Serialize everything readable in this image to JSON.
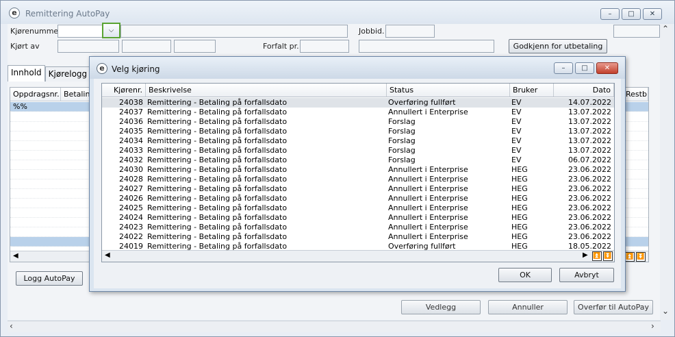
{
  "window": {
    "title": "Remittering AutoPay",
    "app_icon": "e",
    "controls": {
      "minimize": "–",
      "maximize": "□",
      "close": "✕"
    }
  },
  "form": {
    "kjorenummer_label": "Kjørenummer",
    "kjort_av_label": "Kjørt av",
    "forfalt_label": "Forfalt pr.",
    "jobbid_label": "Jobbid.",
    "dropdown_glyph": "⌵",
    "godkjenn_button": "Godkjenn for utbetaling"
  },
  "tabs": [
    {
      "label": "Innhold",
      "active": true
    },
    {
      "label": "Kjørelogg",
      "active": false
    }
  ],
  "grid": {
    "columns": [
      "Oppdragsnr.",
      "Betaling",
      "Restb"
    ],
    "first_row_value": "%%"
  },
  "bottom": {
    "logg_button": "Logg AutoPay",
    "vedlegg_button": "Vedlegg",
    "annuller_button": "Annuller",
    "overfor_button": "Overfør til AutoPay"
  },
  "dialog": {
    "title": "Velg kjøring",
    "columns": [
      "Kjørenr.",
      "Beskrivelse",
      "Status",
      "Bruker",
      "Dato"
    ],
    "rows": [
      {
        "nr": "24038",
        "beskrivelse": "Remittering - Betaling på forfallsdato",
        "status": "Overføring fullført",
        "bruker": "EV",
        "dato": "14.07.2022"
      },
      {
        "nr": "24037",
        "beskrivelse": "Remittering - Betaling på forfallsdato",
        "status": "Annullert i Enterprise",
        "bruker": "EV",
        "dato": "13.07.2022"
      },
      {
        "nr": "24036",
        "beskrivelse": "Remittering - Betaling på forfallsdato",
        "status": "Forslag",
        "bruker": "EV",
        "dato": "13.07.2022"
      },
      {
        "nr": "24035",
        "beskrivelse": "Remittering - Betaling på forfallsdato",
        "status": "Forslag",
        "bruker": "EV",
        "dato": "13.07.2022"
      },
      {
        "nr": "24034",
        "beskrivelse": "Remittering - Betaling på forfallsdato",
        "status": "Forslag",
        "bruker": "EV",
        "dato": "13.07.2022"
      },
      {
        "nr": "24033",
        "beskrivelse": "Remittering - Betaling på forfallsdato",
        "status": "Forslag",
        "bruker": "EV",
        "dato": "13.07.2022"
      },
      {
        "nr": "24032",
        "beskrivelse": "Remittering - Betaling på forfallsdato",
        "status": "Forslag",
        "bruker": "EV",
        "dato": "06.07.2022"
      },
      {
        "nr": "24030",
        "beskrivelse": "Remittering - Betaling på forfallsdato",
        "status": "Annullert i Enterprise",
        "bruker": "HEG",
        "dato": "23.06.2022"
      },
      {
        "nr": "24028",
        "beskrivelse": "Remittering - Betaling på forfallsdato",
        "status": "Annullert i Enterprise",
        "bruker": "HEG",
        "dato": "23.06.2022"
      },
      {
        "nr": "24027",
        "beskrivelse": "Remittering - Betaling på forfallsdato",
        "status": "Annullert i Enterprise",
        "bruker": "HEG",
        "dato": "23.06.2022"
      },
      {
        "nr": "24026",
        "beskrivelse": "Remittering - Betaling på forfallsdato",
        "status": "Annullert i Enterprise",
        "bruker": "HEG",
        "dato": "23.06.2022"
      },
      {
        "nr": "24025",
        "beskrivelse": "Remittering - Betaling på forfallsdato",
        "status": "Annullert i Enterprise",
        "bruker": "HEG",
        "dato": "23.06.2022"
      },
      {
        "nr": "24024",
        "beskrivelse": "Remittering - Betaling på forfallsdato",
        "status": "Annullert i Enterprise",
        "bruker": "HEG",
        "dato": "23.06.2022"
      },
      {
        "nr": "24023",
        "beskrivelse": "Remittering - Betaling på forfallsdato",
        "status": "Annullert i Enterprise",
        "bruker": "HEG",
        "dato": "23.06.2022"
      },
      {
        "nr": "24022",
        "beskrivelse": "Remittering - Betaling på forfallsdato",
        "status": "Annullert i Enterprise",
        "bruker": "HEG",
        "dato": "23.06.2022"
      },
      {
        "nr": "24019",
        "beskrivelse": "Remittering - Betaling på forfallsdato",
        "status": "Overføring fullført",
        "bruker": "HEG",
        "dato": "18.05.2022"
      }
    ],
    "ok_button": "OK",
    "avbryt_button": "Avbryt"
  },
  "colors": {
    "selection": "#b9d1ea",
    "focus_border": "#59a331",
    "close_red": "#c2402c"
  }
}
